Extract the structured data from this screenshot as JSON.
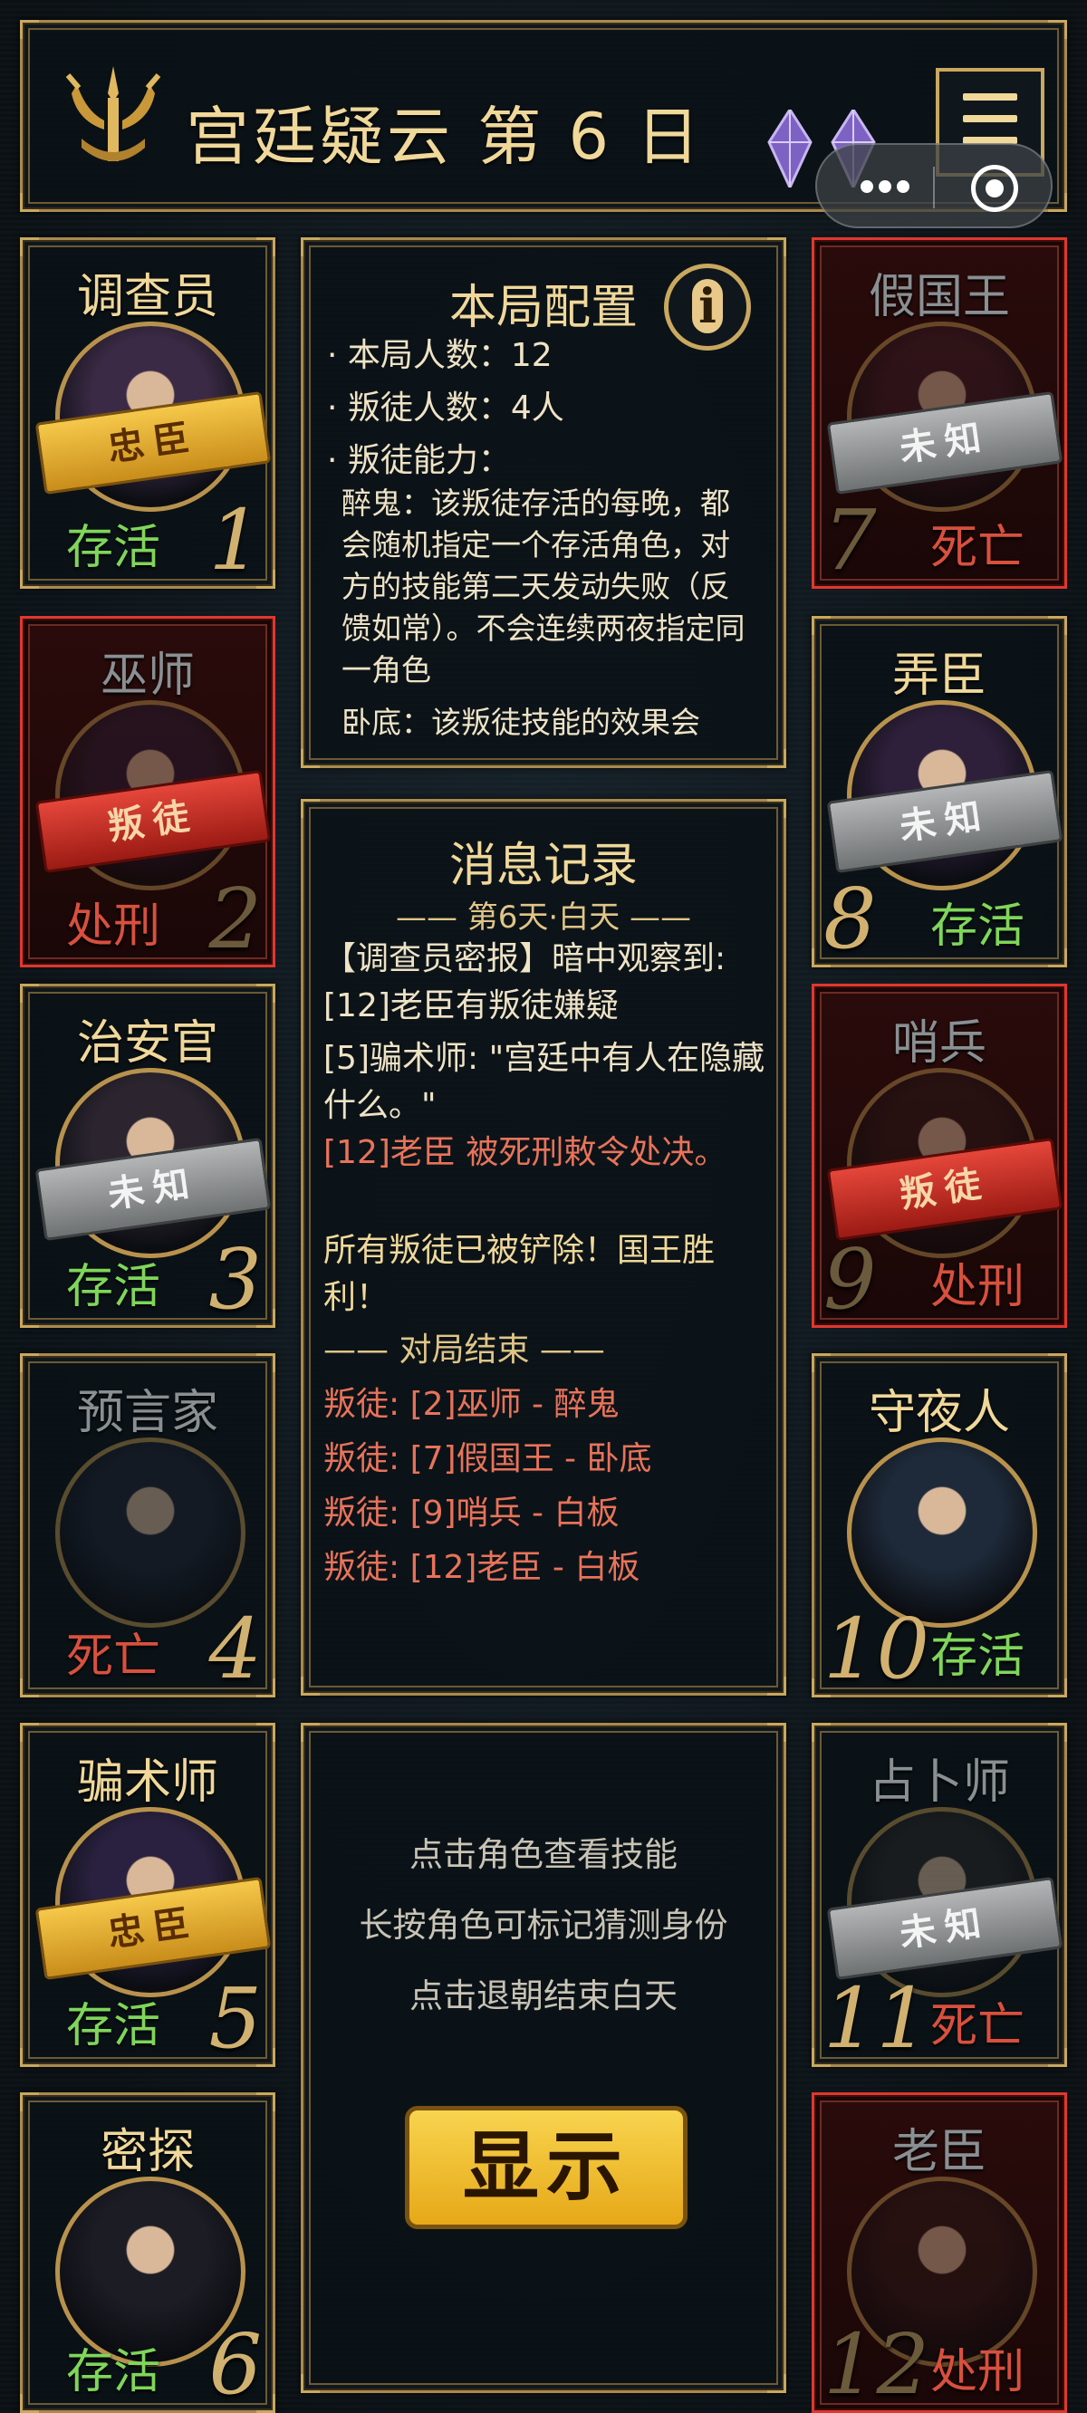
{
  "header": {
    "title": "宫廷疑云 第 6 日",
    "gem_color": "#9b7bd8",
    "menu_icon": "menu-icon"
  },
  "players": [
    {
      "id": 1,
      "name": "调查员",
      "badge": "忠臣",
      "badge_type": "gold",
      "status": "存活",
      "num": "1",
      "status_type": "alive",
      "highlight": false,
      "dim": false
    },
    {
      "id": 2,
      "name": "巫师",
      "badge": "叛徒",
      "badge_type": "red",
      "status": "处刑",
      "num": "2",
      "status_type": "dead",
      "highlight": true,
      "dim": true
    },
    {
      "id": 3,
      "name": "治安官",
      "badge": "未知",
      "badge_type": "grey",
      "status": "存活",
      "num": "3",
      "status_type": "alive",
      "highlight": false,
      "dim": false
    },
    {
      "id": 4,
      "name": "预言家",
      "badge": "",
      "badge_type": "",
      "status": "死亡",
      "num": "4",
      "status_type": "dead",
      "highlight": false,
      "dim": true
    },
    {
      "id": 5,
      "name": "骗术师",
      "badge": "忠臣",
      "badge_type": "gold",
      "status": "存活",
      "num": "5",
      "status_type": "alive",
      "highlight": false,
      "dim": false
    },
    {
      "id": 6,
      "name": "密探",
      "badge": "",
      "badge_type": "",
      "status": "存活",
      "num": "6",
      "status_type": "alive",
      "highlight": false,
      "dim": false
    },
    {
      "id": 7,
      "name": "假国王",
      "badge": "未知",
      "badge_type": "grey",
      "status": "死亡",
      "num": "7",
      "status_type": "dead",
      "highlight": true,
      "dim": true
    },
    {
      "id": 8,
      "name": "弄臣",
      "badge": "未知",
      "badge_type": "grey",
      "status": "存活",
      "num": "8",
      "status_type": "alive",
      "highlight": false,
      "dim": false
    },
    {
      "id": 9,
      "name": "哨兵",
      "badge": "叛徒",
      "badge_type": "red",
      "status": "处刑",
      "num": "9",
      "status_type": "dead",
      "highlight": true,
      "dim": true
    },
    {
      "id": 10,
      "name": "守夜人",
      "badge": "",
      "badge_type": "",
      "status": "存活",
      "num": "10",
      "status_type": "alive",
      "highlight": false,
      "dim": false
    },
    {
      "id": 11,
      "name": "占卜师",
      "badge": "未知",
      "badge_type": "grey",
      "status": "死亡",
      "num": "11",
      "status_type": "dead",
      "highlight": false,
      "dim": true
    },
    {
      "id": 12,
      "name": "老臣",
      "badge": "",
      "badge_type": "",
      "status": "处刑",
      "num": "12",
      "status_type": "dead",
      "highlight": true,
      "dim": true
    }
  ],
  "config": {
    "title": "本局配置",
    "info_icon": "info-icon",
    "player_count": "· 本局人数：12",
    "traitor_count": "· 叛徒人数：4人",
    "ability_label": "· 叛徒能力：",
    "ability_1": "醉鬼：该叛徒存活的每晚，都会随机指定一个存活角色，对方的技能第二天发动失败（反馈如常）。不会连续两夜指定同一角色",
    "ability_2": "卧底：该叛徒技能的效果会"
  },
  "log": {
    "title": "消息记录",
    "day_header": "—— 第6天·白天 ——",
    "lines": [
      "【调查员密报】暗中观察到: [12]老臣有叛徒嫌疑",
      "[5]骗术师: \"宫廷中有人在隐藏什么。\"",
      "[12]老臣 被死刑敕令处决。",
      "所有叛徒已被铲除！国王胜利！"
    ],
    "end_header": "—— 对局结束 ——",
    "reveals": [
      "叛徒: [2]巫师 - 醉鬼",
      "叛徒: [7]假国王 - 卧底",
      "叛徒: [9]哨兵 - 白板",
      "叛徒: [12]老臣 - 白板"
    ]
  },
  "action": {
    "hint_1": "点击角色查看技能",
    "hint_2": "长按角色可标记猜测身份",
    "hint_3": "点击退朝结束白天",
    "show_label": "显示"
  },
  "colors": {
    "gold": "#c9a85f",
    "alive": "#7fd65a",
    "dead": "#d8503e",
    "highlight": "#e0372f"
  }
}
